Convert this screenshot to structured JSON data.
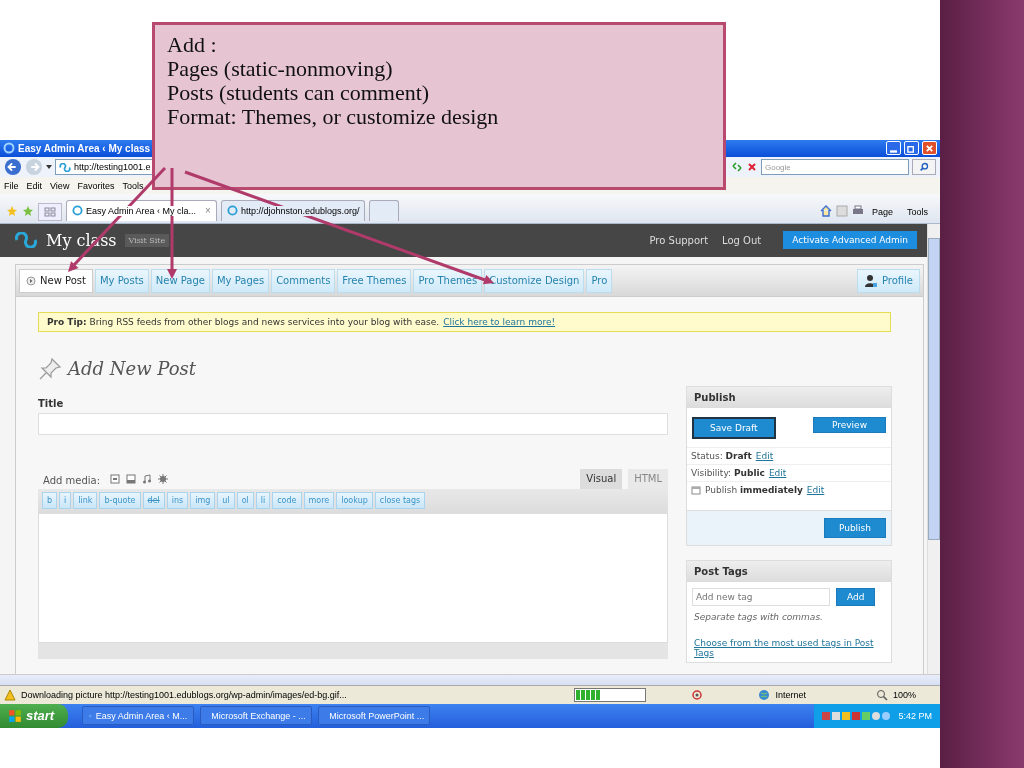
{
  "callout": {
    "lines": [
      "Add :",
      "Pages (static-nonmoving)",
      "Posts (students can comment)",
      "Format: Themes, or customize design"
    ]
  },
  "browser": {
    "title": "Easy Admin Area ‹ My class",
    "url": "http://testing1001.e",
    "search_placeholder": "Google",
    "menu": [
      "File",
      "Edit",
      "View",
      "Favorites",
      "Tools"
    ],
    "tabs": [
      {
        "label": "Easy Admin Area ‹ My cla...",
        "selected": true
      },
      {
        "label": "http://djohnston.edublogs.org/",
        "selected": false
      }
    ],
    "tab_close": "×",
    "command_bar": [
      "Page",
      "Tools"
    ]
  },
  "wp": {
    "site_title": "My class",
    "visit_site": "Visit Site",
    "header_links": [
      "Pro Support",
      "Log Out"
    ],
    "admin_button": "Activate Advanced Admin",
    "nav_tabs": [
      {
        "label": "New Post",
        "selected": true
      },
      {
        "label": "My Posts",
        "selected": false
      },
      {
        "label": "New Page",
        "selected": false
      },
      {
        "label": "My Pages",
        "selected": false
      },
      {
        "label": "Comments",
        "selected": false
      },
      {
        "label": "Free Themes",
        "selected": false
      },
      {
        "label": "Pro Themes",
        "selected": false
      },
      {
        "label": "Customize Design",
        "selected": false
      },
      {
        "label": "Pro",
        "selected": false
      }
    ],
    "profile": "Profile",
    "pro_tip": {
      "text": "**Pro Tip:** Bring RSS feeds from other blogs and news services into your blog with ease.",
      "link": "Click here to learn more!"
    },
    "heading": "Add New Post",
    "title_label": "Title",
    "add_media": "Add media:",
    "editor_tabs": [
      {
        "label": "Visual",
        "selected": true
      },
      {
        "label": "HTML",
        "selected": false
      }
    ],
    "quicktags": [
      {
        "label": "b",
        "struck": false
      },
      {
        "label": "i",
        "struck": false
      },
      {
        "label": "link",
        "struck": false
      },
      {
        "label": "b-quote",
        "struck": false
      },
      {
        "label": "del",
        "struck": true
      },
      {
        "label": "ins",
        "struck": false
      },
      {
        "label": "img",
        "struck": false
      },
      {
        "label": "ul",
        "struck": false
      },
      {
        "label": "ol",
        "struck": false
      },
      {
        "label": "li",
        "struck": false
      },
      {
        "label": "code",
        "struck": false
      },
      {
        "label": "more",
        "struck": false
      },
      {
        "label": "lookup",
        "struck": false
      },
      {
        "label": "close tags",
        "struck": false
      }
    ],
    "publish": {
      "title": "Publish",
      "save_draft": "Save Draft",
      "preview": "Preview",
      "rows": [
        {
          "text": "Status: **Draft**",
          "link": "Edit",
          "kind": "plain"
        },
        {
          "text": "Visibility: **Public**",
          "link": "Edit",
          "kind": "plain"
        },
        {
          "text": "Publish **immediately**",
          "link": "Edit",
          "kind": "calendar"
        }
      ],
      "publish_button": "Publish"
    },
    "tags": {
      "title": "Post Tags",
      "placeholder": "Add new tag",
      "add": "Add",
      "hint": "Separate tags with commas.",
      "link": "Choose from the most used tags in Post Tags"
    }
  },
  "status_bar": {
    "text": "Downloading picture http://testing1001.edublogs.org/wp-admin/images/ed-bg.gif...",
    "level": 0.35,
    "zone": "Internet",
    "zoom": "100%"
  },
  "taskbar": {
    "start": "start",
    "items": [
      "Easy Admin Area ‹ M...",
      "Microsoft Exchange - ...",
      "Microsoft PowerPoint ..."
    ],
    "clock": "5:42 PM"
  }
}
